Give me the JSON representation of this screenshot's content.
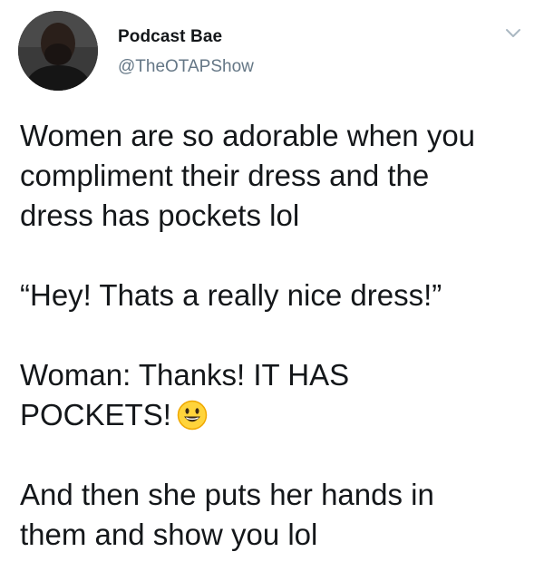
{
  "author": {
    "display_name": "Podcast Bae",
    "handle": "@TheOTAPShow",
    "avatar_icon": "profile-photo"
  },
  "menu_icon": "chevron-down-icon",
  "tweet": {
    "paragraphs": [
      {
        "lines": [
          "Women are so adorable when you",
          "compliment their dress and the",
          "dress has pockets lol"
        ]
      },
      {
        "lines": [
          "“Hey! Thats a really nice dress!”"
        ]
      },
      {
        "lines": [
          "Woman: Thanks! IT HAS",
          "POCKETS!"
        ],
        "emoji": "grinning-face-emoji"
      },
      {
        "lines": [
          "And then she puts her hands in",
          "them and show you lol"
        ]
      }
    ]
  },
  "colors": {
    "text": "#14171a",
    "secondary": "#657786",
    "chevron": "#aab8c2",
    "emoji_fill": "#ffd43b",
    "emoji_stroke": "#f0a800"
  }
}
